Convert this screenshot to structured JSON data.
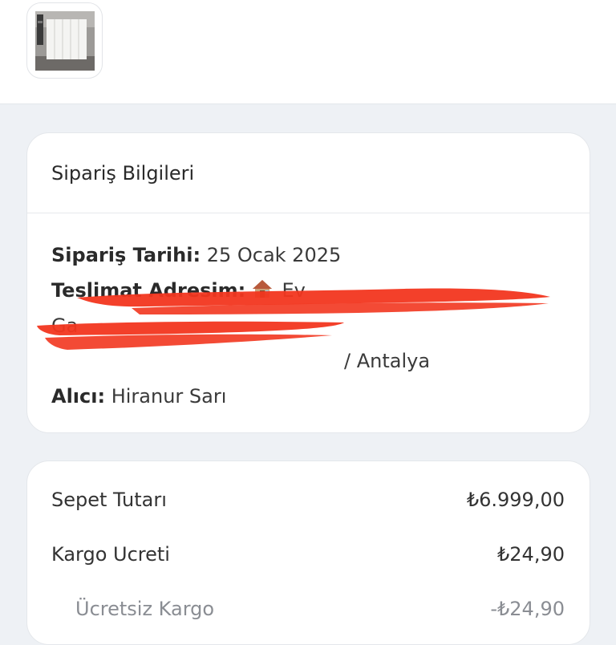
{
  "order_info": {
    "title": "Sipariş Bilgileri",
    "date_label": "Sipariş Tarihi:",
    "date_value": "25 Ocak 2025",
    "address_label": "Teslimat Adresim:",
    "address_name": "Ev",
    "address_line1_visible": "Ga",
    "address_line2_visible": "/ Antalya",
    "recipient_label": "Alıcı:",
    "recipient_value": "Hiranur Sarı"
  },
  "summary": {
    "rows": [
      {
        "label": "Sepet Tutarı",
        "value": "₺6.999,00"
      },
      {
        "label": "Kargo Ucreti",
        "value": "₺24,90"
      },
      {
        "label": "Ücretsiz Kargo",
        "value": "-₺24,90"
      }
    ]
  },
  "icons": {
    "address_icon": "house-icon",
    "product": "wardrobe-product-thumbnail"
  },
  "colors": {
    "redaction": "#f2361f",
    "page_bg": "#eef1f5"
  }
}
